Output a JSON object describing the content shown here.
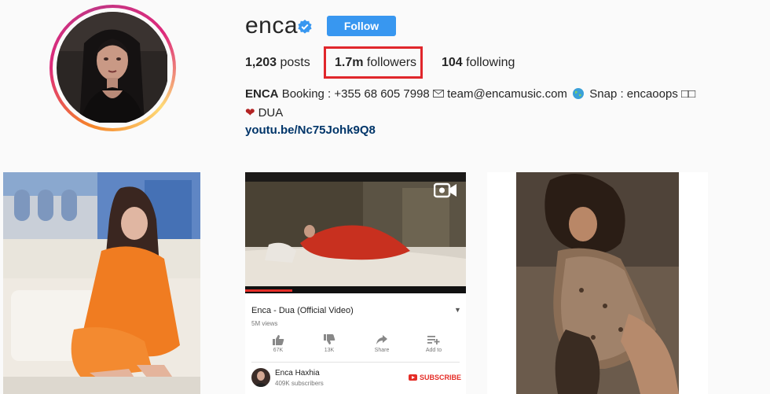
{
  "profile": {
    "username": "enca",
    "follow_label": "Follow",
    "stats": {
      "posts_count": "1,203",
      "posts_label": "posts",
      "followers_count": "1.7m",
      "followers_label": "followers",
      "following_count": "104",
      "following_label": "following"
    },
    "bio": {
      "name": "ENCA",
      "line1_rest": "Booking : +355 68 605 7998",
      "email": "team@encamusic.com",
      "snap": "Snap : encaoops",
      "snap_suffix": "□□",
      "line2": "DUA",
      "link": "youtu.be/Nc75Johk9Q8"
    }
  },
  "posts": [
    {
      "kind": "photo"
    },
    {
      "kind": "video",
      "youtube": {
        "title": "Enca - Dua (Official Video)",
        "views": "5M views",
        "actions": [
          {
            "icon": "thumbs-up-icon",
            "label": "67K"
          },
          {
            "icon": "thumbs-down-icon",
            "label": "13K"
          },
          {
            "icon": "share-icon",
            "label": "Share"
          },
          {
            "icon": "add-to-playlist-icon",
            "label": "Add to"
          }
        ],
        "channel": "Enca Haxhia",
        "subscribers": "409K subscribers",
        "subscribe_label": "SUBSCRIBE"
      }
    },
    {
      "kind": "photo"
    }
  ],
  "colors": {
    "follow_button": "#3897f0",
    "highlight": "#e0262b",
    "link": "#003569",
    "background": "#fafafa"
  }
}
